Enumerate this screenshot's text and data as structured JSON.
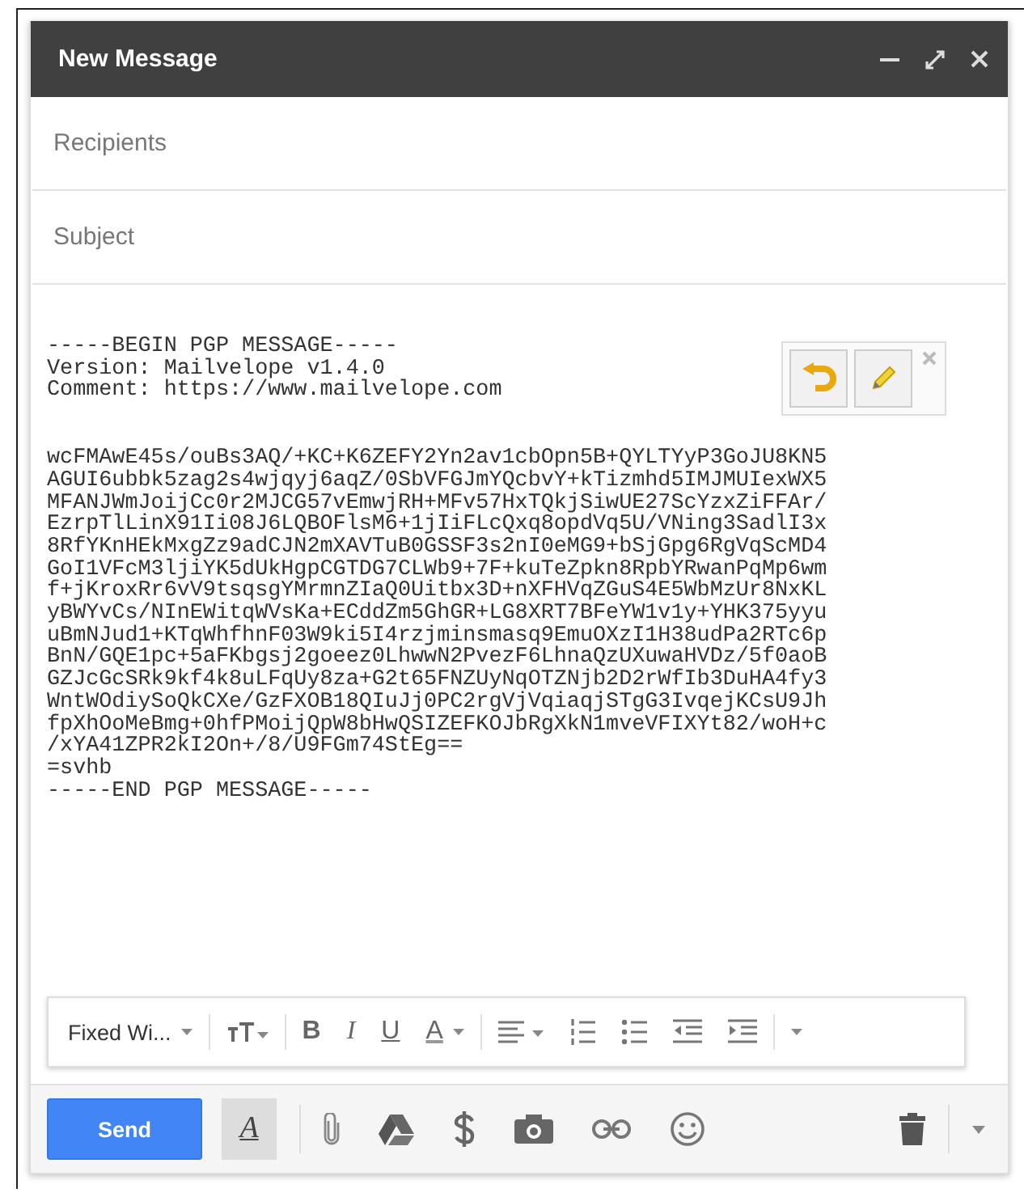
{
  "window": {
    "title": "New Message"
  },
  "recipients": {
    "placeholder": "Recipients"
  },
  "subject": {
    "placeholder": "Subject"
  },
  "body": {
    "blocks": [
      {
        "lines": [
          "-----BEGIN PGP MESSAGE-----",
          "Version: Mailvelope v1.4.0",
          "Comment: https://www.mailvelope.com"
        ]
      },
      {
        "lines": [
          "wcFMAwE45s/ouBs3AQ/+KC+K6ZEFY2Yn2av1cbOpn5B+QYLTYyP3GoJU8KN5",
          "AGUI6ubbk5zag2s4wjqyj6aqZ/0SbVFGJmYQcbvY+kTizmhd5IMJMUIexWX5",
          "MFANJWmJoijCc0r2MJCG57vEmwjRH+MFv57HxTQkjSiwUE27ScYzxZiFFAr/",
          "EzrpTlLinX91Ii08J6LQBOFlsM6+1jIiFLcQxq8opdVq5U/VNing3SadlI3x",
          "8RfYKnHEkMxgZz9adCJN2mXAVTuB0GSSF3s2nI0eMG9+bSjGpg6RgVqScMD4",
          "GoI1VFcM3ljiYK5dUkHgpCGTDG7CLWb9+7F+kuTeZpkn8RpbYRwanPqMp6wm",
          "f+jKroxRr6vV9tsqsgYMrmnZIaQ0Uitbx3D+nXFHVqZGuS4E5WbMzUr8NxKL",
          "yBWYvCs/NInEWitqWVsKa+ECddZm5GhGR+LG8XRT7BFeYW1v1y+YHK375yyu",
          "uBmNJud1+KTqWhfhnF03W9ki5I4rzjminsmasq9EmuOXzI1H38udPa2RTc6p",
          "BnN/GQE1pc+5aFKbgsj2goeez0LhwwN2PvezF6LhnaQzUXuwaHVDz/5f0aoB",
          "GZJcGcSRk9kf4k8uLFqUy8za+G2t65FNZUyNqOTZNjb2D2rWfIb3DuHA4fy3",
          "WntWOdiySoQkCXe/GzFXOB18QIuJj0PC2rgVjVqiaqjSTgG3IvqejKCsU9Jh",
          "fpXhOoMeBmg+0hfPMoijQpW8bHwQSIZEFKOJbRgXkN1mveVFIXYt82/woH+c",
          "/xYA41ZPR2kI2On+/8/U9FGm74StEg==",
          "=svhb",
          "-----END PGP MESSAGE-----"
        ]
      }
    ]
  },
  "format_toolbar": {
    "font": "Fixed Wi...",
    "bold": "B",
    "italic": "I",
    "underline": "U",
    "text_color": "A"
  },
  "bottom_bar": {
    "send": "Send",
    "formatting": {
      "label": "A",
      "selected": true
    }
  }
}
